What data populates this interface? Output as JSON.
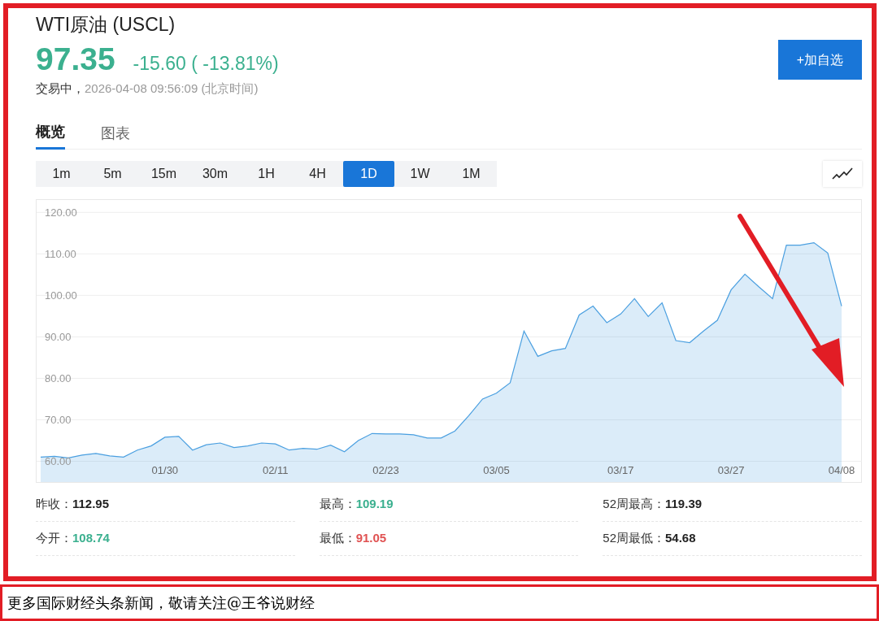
{
  "header": {
    "title": "WTI原油 (USCL)",
    "price": "97.35",
    "change": "-15.60 ( -13.81%)",
    "status": "交易中，",
    "timestamp": "2026-04-08 09:56:09 (北京时间)",
    "watch_button": "+加自选"
  },
  "tabs": [
    {
      "label": "概览",
      "selected": true
    },
    {
      "label": "图表",
      "selected": false
    }
  ],
  "periods": [
    {
      "label": "1m",
      "selected": false
    },
    {
      "label": "5m",
      "selected": false
    },
    {
      "label": "15m",
      "selected": false
    },
    {
      "label": "30m",
      "selected": false
    },
    {
      "label": "1H",
      "selected": false
    },
    {
      "label": "4H",
      "selected": false
    },
    {
      "label": "1D",
      "selected": true
    },
    {
      "label": "1W",
      "selected": false
    },
    {
      "label": "1M",
      "selected": false
    }
  ],
  "chart": {
    "chart_data": {
      "type": "area",
      "categories": [
        null,
        null,
        null,
        null,
        null,
        null,
        null,
        null,
        null,
        "01/30",
        null,
        null,
        null,
        null,
        null,
        null,
        null,
        "02/11",
        null,
        null,
        null,
        null,
        null,
        null,
        null,
        "02/23",
        null,
        null,
        null,
        null,
        null,
        null,
        null,
        "03/05",
        null,
        null,
        null,
        null,
        null,
        null,
        null,
        null,
        "03/17",
        null,
        null,
        null,
        null,
        null,
        null,
        null,
        "03/27",
        null,
        null,
        null,
        null,
        null,
        null,
        null,
        "04/08"
      ],
      "series": [
        {
          "color": "#4a9fe0",
          "values": [
            61.0,
            61.2,
            60.8,
            61.5,
            61.9,
            61.3,
            61.0,
            62.7,
            63.7,
            65.8,
            66.0,
            62.7,
            64.0,
            64.4,
            63.3,
            63.7,
            64.4,
            64.2,
            62.7,
            63.1,
            62.9,
            63.9,
            62.3,
            65.0,
            66.7,
            66.6,
            66.6,
            66.4,
            65.6,
            65.6,
            67.3,
            71.0,
            75.0,
            76.4,
            78.9,
            91.4,
            85.3,
            86.6,
            87.2,
            95.3,
            97.4,
            93.4,
            95.5,
            99.2,
            94.9,
            98.2,
            89.1,
            88.6,
            91.4,
            94.0,
            101.3,
            105.1,
            102.1,
            99.2,
            112.1,
            112.1,
            112.7,
            110.2,
            97.4
          ]
        }
      ],
      "ylim": [
        55,
        123
      ],
      "grid": true,
      "yticks": [
        {
          "value": 60,
          "label": "60.00"
        },
        {
          "value": 70,
          "label": "70.00"
        },
        {
          "value": 80,
          "label": "80.00"
        },
        {
          "value": 90,
          "label": "90.00"
        },
        {
          "value": 100,
          "label": "100.00"
        },
        {
          "value": 110,
          "label": "110.00"
        },
        {
          "value": 120,
          "label": "120.00"
        }
      ]
    }
  },
  "stats": [
    {
      "label": "昨收：",
      "value": "112.95",
      "color": "#222222"
    },
    {
      "label": "最高：",
      "value": "109.19",
      "color": "#3bb08f"
    },
    {
      "label": "52周最高：",
      "value": "119.39",
      "color": "#222222"
    },
    {
      "label": "今开：",
      "value": "108.74",
      "color": "#3bb08f"
    },
    {
      "label": "最低：",
      "value": "91.05",
      "color": "#e05252"
    },
    {
      "label": "52周最低：",
      "value": "54.68",
      "color": "#222222"
    }
  ],
  "caption": "更多国际财经头条新闻，敬请关注@王爷说财经"
}
